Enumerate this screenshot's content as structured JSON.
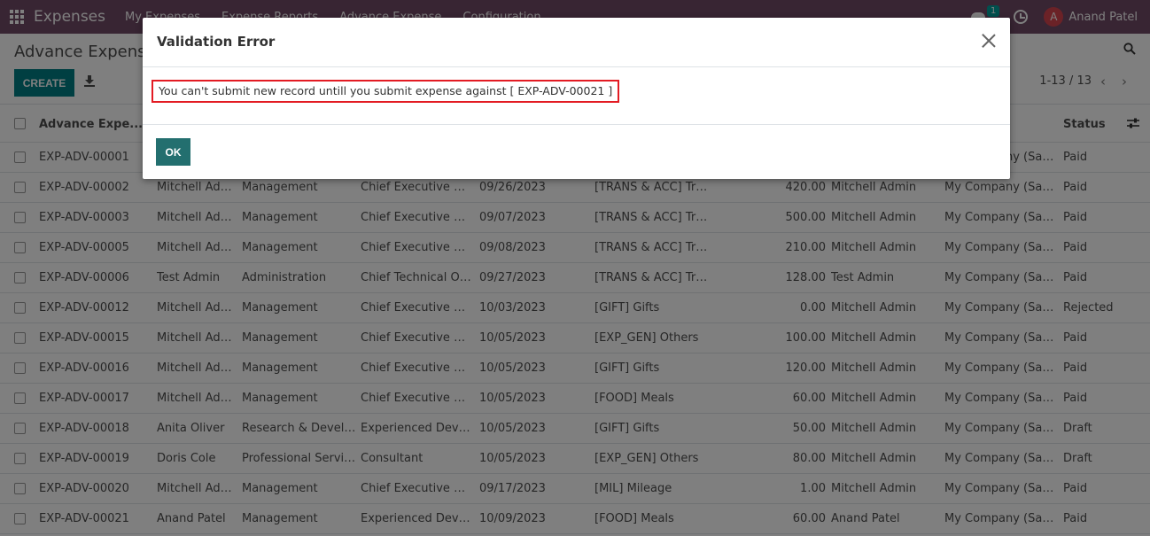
{
  "navbar": {
    "brand": "Expenses",
    "menus": [
      "My Expenses",
      "Expense Reports",
      "Advance Expense",
      "Configuration"
    ],
    "chat_count": "1",
    "avatar_letter": "A",
    "user_name": "Anand Patel"
  },
  "control": {
    "title": "Advance Expense",
    "create_label": "CREATE",
    "pager": "1-13 / 13"
  },
  "table": {
    "headers": {
      "ref": "Advance Expe...",
      "status": "Status"
    },
    "rows": [
      {
        "ref": "EXP-ADV-00001",
        "employee": "",
        "department": "",
        "job": "",
        "date": "",
        "product": "",
        "amount": "",
        "manager": "",
        "company": "My Company (San Francisco)",
        "status": "Paid"
      },
      {
        "ref": "EXP-ADV-00002",
        "employee": "Mitchell Admin",
        "department": "Management",
        "job": "Chief Executive Officer",
        "date": "09/26/2023",
        "product": "[TRANS & ACC] Travel & Accommodation",
        "amount": "420.00",
        "manager": "Mitchell Admin",
        "company": "My Company (San Francisco)",
        "status": "Paid"
      },
      {
        "ref": "EXP-ADV-00003",
        "employee": "Mitchell Admin",
        "department": "Management",
        "job": "Chief Executive Officer",
        "date": "09/07/2023",
        "product": "[TRANS & ACC] Travel & Accommodation",
        "amount": "500.00",
        "manager": "Mitchell Admin",
        "company": "My Company (San Francisco)",
        "status": "Paid"
      },
      {
        "ref": "EXP-ADV-00005",
        "employee": "Mitchell Admin",
        "department": "Management",
        "job": "Chief Executive Officer",
        "date": "09/08/2023",
        "product": "[TRANS & ACC] Travel & Accommodation",
        "amount": "210.00",
        "manager": "Mitchell Admin",
        "company": "My Company (San Francisco)",
        "status": "Paid"
      },
      {
        "ref": "EXP-ADV-00006",
        "employee": "Test Admin",
        "department": "Administration",
        "job": "Chief Technical Officer",
        "date": "09/27/2023",
        "product": "[TRANS & ACC] Travel & Accommodation",
        "amount": "128.00",
        "manager": "Test Admin",
        "company": "My Company (San Francisco)",
        "status": "Paid"
      },
      {
        "ref": "EXP-ADV-00012",
        "employee": "Mitchell Admin",
        "department": "Management",
        "job": "Chief Executive Officer",
        "date": "10/03/2023",
        "product": "[GIFT] Gifts",
        "amount": "0.00",
        "manager": "Mitchell Admin",
        "company": "My Company (San Francisco)",
        "status": "Rejected"
      },
      {
        "ref": "EXP-ADV-00015",
        "employee": "Mitchell Admin",
        "department": "Management",
        "job": "Chief Executive Officer",
        "date": "10/05/2023",
        "product": "[EXP_GEN] Others",
        "amount": "100.00",
        "manager": "Mitchell Admin",
        "company": "My Company (San Francisco)",
        "status": "Paid"
      },
      {
        "ref": "EXP-ADV-00016",
        "employee": "Mitchell Admin",
        "department": "Management",
        "job": "Chief Executive Officer",
        "date": "10/05/2023",
        "product": "[GIFT] Gifts",
        "amount": "120.00",
        "manager": "Mitchell Admin",
        "company": "My Company (San Francisco)",
        "status": "Paid"
      },
      {
        "ref": "EXP-ADV-00017",
        "employee": "Mitchell Admin",
        "department": "Management",
        "job": "Chief Executive Officer",
        "date": "10/05/2023",
        "product": "[FOOD] Meals",
        "amount": "60.00",
        "manager": "Mitchell Admin",
        "company": "My Company (San Francisco)",
        "status": "Paid"
      },
      {
        "ref": "EXP-ADV-00018",
        "employee": "Anita Oliver",
        "department": "Research & Development",
        "job": "Experienced Developer",
        "date": "10/05/2023",
        "product": "[GIFT] Gifts",
        "amount": "50.00",
        "manager": "Mitchell Admin",
        "company": "My Company (San Francisco)",
        "status": "Draft"
      },
      {
        "ref": "EXP-ADV-00019",
        "employee": "Doris Cole",
        "department": "Professional Services",
        "job": "Consultant",
        "date": "10/05/2023",
        "product": "[EXP_GEN] Others",
        "amount": "80.00",
        "manager": "Mitchell Admin",
        "company": "My Company (San Francisco)",
        "status": "Draft"
      },
      {
        "ref": "EXP-ADV-00020",
        "employee": "Mitchell Admin",
        "department": "Management",
        "job": "Chief Executive Officer",
        "date": "09/17/2023",
        "product": "[MIL] Mileage",
        "amount": "1.00",
        "manager": "Mitchell Admin",
        "company": "My Company (San Francisco)",
        "status": "Paid"
      },
      {
        "ref": "EXP-ADV-00021",
        "employee": "Anand Patel",
        "department": "Management",
        "job": "Experienced Developer",
        "date": "10/09/2023",
        "product": "[FOOD] Meals",
        "amount": "60.00",
        "manager": "Anand Patel",
        "company": "My Company (San Francisco)",
        "status": "Paid"
      }
    ]
  },
  "dialog": {
    "title": "Validation Error",
    "message": "You can't submit new record untill you submit expense against [ EXP-ADV-00021 ]",
    "ok_label": "OK",
    "highlight_color": "#E31B23"
  },
  "colors": {
    "navbar": "#714B67",
    "create_button": "#017E84",
    "ok_button": "#236F6F"
  }
}
